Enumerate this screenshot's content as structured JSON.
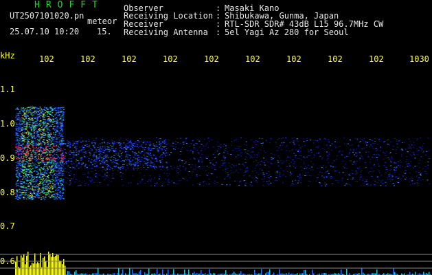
{
  "app": {
    "title": "HROFFT"
  },
  "capture": {
    "filename": "UT2507101020.pn",
    "meteor_label": "meteor",
    "datetime": "25.07.10 10:20",
    "meteor_count": "15."
  },
  "station": [
    {
      "label": "Observer",
      "value": "Masaki Kano"
    },
    {
      "label": "Receiving Location",
      "value": "Shibukawa, Gunma, Japan"
    },
    {
      "label": "Receiver",
      "value": "RTL-SDR SDR# 43dB L15 96.7MHz CW"
    },
    {
      "label": "Receiving Antenna",
      "value": "5el Yagi Az 280 for Seoul"
    }
  ],
  "y_axis": {
    "unit": "kHz",
    "ticks": [
      "1.1",
      "1.0",
      "0.9",
      "0.8",
      "0.7",
      "0.6"
    ]
  },
  "x_axis": {
    "ticks": [
      "102",
      "102",
      "102",
      "102",
      "102",
      "102",
      "102",
      "102",
      "102",
      "1030"
    ]
  },
  "colors": {
    "title": "#1fd32b",
    "header_text": "#e8e8e8",
    "axis_text": "#ffff38",
    "echo_core": "#ff3060",
    "histogram": "#ffff38"
  }
}
